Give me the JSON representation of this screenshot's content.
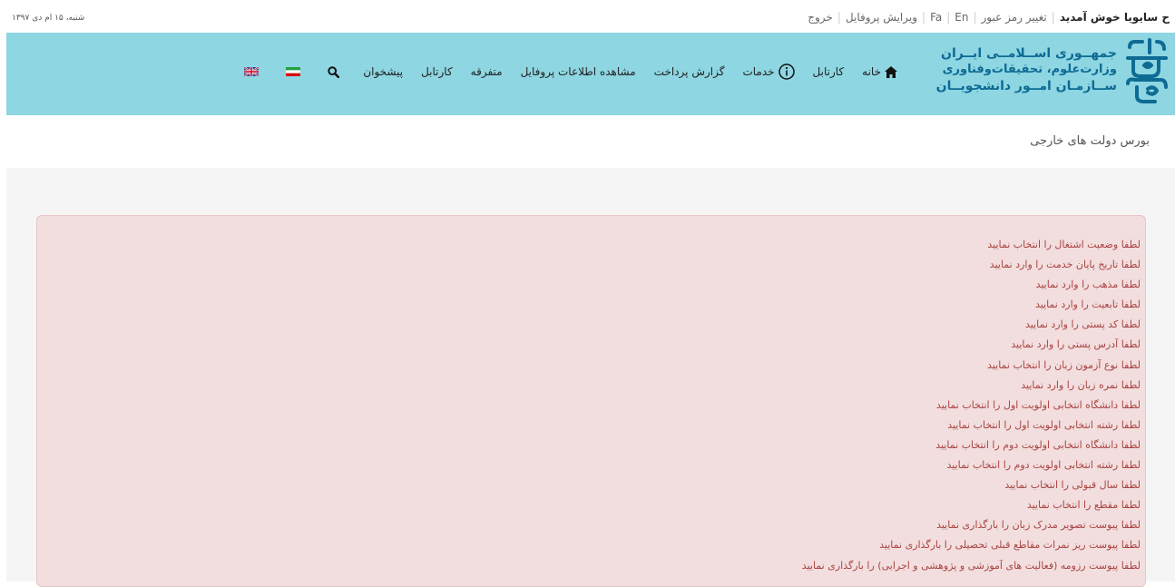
{
  "topbar": {
    "date": "شنبه، ۱۵ ام دی ۱۳۹۷",
    "welcome_name": "ح سایویا",
    "welcome_text": " خوش آمدید",
    "change_password": "تغییر رمز عبور",
    "lang_fa": "Fa",
    "lang_en": "En",
    "edit_profile": "ویرایش پروفایل",
    "logout": "خروج"
  },
  "logo": {
    "line1": "جمهــوری اســلامــی ایــران",
    "line2": "وزارت‌علوم، تحقیقات‌وفناوری",
    "line3": "ســازمـان امــور دانشجویــان",
    "emblem_color": "#0e6b94"
  },
  "nav": {
    "items": [
      {
        "label": "خانه",
        "icon": "home-icon"
      },
      {
        "label": "کارتابل"
      },
      {
        "label": "خدمات",
        "icon": "info-circle-icon"
      },
      {
        "label": "گزارش پرداخت"
      },
      {
        "label": "مشاهده اطلاعات پروفایل"
      },
      {
        "label": "متفرقه"
      },
      {
        "label": "کارتابل"
      },
      {
        "label": "پیشخوان"
      }
    ]
  },
  "tools": {
    "search_icon": "search-icon",
    "iran_flag": "iran-flag-icon",
    "uk_flag": "uk-flag-icon"
  },
  "page": {
    "title": "بورس دولت های خارجی"
  },
  "alert": {
    "color": "#a94442",
    "background": "#f2dede",
    "errors": [
      "لطفا وضعیت اشتغال را انتخاب نمایید",
      "لطفا تاریخ پایان خدمت را وارد نمایید",
      "لطفا مذهب را وارد نمایید",
      "لطفا تابعیت را وارد نمایید",
      "لطفا کد پستی را وارد نمایید",
      "لطفا آدرس پستی را وارد نمایید",
      "لطفا نوع آزمون زبان را انتخاب نمایید",
      "لطفا نمره زبان را وارد نمایید",
      "لطفا دانشگاه انتخابی اولویت اول را انتخاب نمایید",
      "لطفا رشته انتخابی اولویت اول را انتخاب نمایید",
      "لطفا دانشگاه انتخابی اولویت دوم را انتخاب نمایید",
      "لطفا رشته انتخابی اولویت دوم را انتخاب نمایید",
      "لطفا سال قبولی را انتخاب نمایید",
      "لطفا مقطع را انتخاب نمایید",
      "لطفا پیوست تصویر مدرک زبان را بارگذاری نمایید",
      "لطفا پیوست ریز نمرات مقاطع قبلی تحصیلی را بارگذاری نمایید",
      "لطفا پیوست رزومه (فعالیت های آموزشی و پژوهشی و اجرایی) را بارگذاری نمایید"
    ]
  }
}
